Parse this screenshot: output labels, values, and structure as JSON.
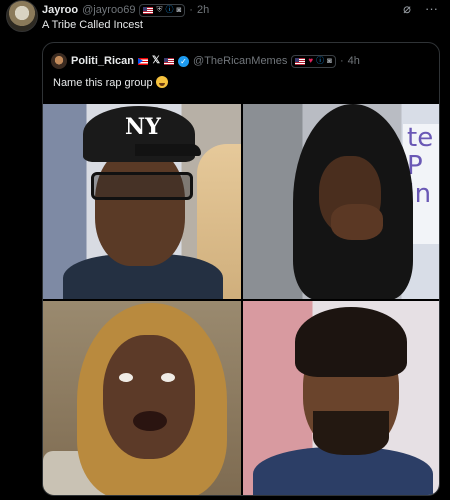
{
  "tweet": {
    "author_name": "Jayroo",
    "handle": "@jayroo69",
    "time": "2h",
    "text": "A Tribe Called Incest",
    "icons": [
      "us-flag-icon",
      "shield-icon",
      "info-icon",
      "camera-icon"
    ]
  },
  "top_actions": {
    "grok_icon": "⌀",
    "more_icon": "···"
  },
  "quoted_tweet": {
    "author_name": "Politi_Rican",
    "handle": "@TheRicanMemes",
    "time": "4h",
    "text": "Name this rap group",
    "header_flags": [
      "puerto-rico-flag-icon",
      "x-icon",
      "us-flag-icon",
      "verified-icon"
    ],
    "badge_icons": [
      "us-flag-icon",
      "heart-icon",
      "info-icon",
      "camera-icon"
    ],
    "emoji": "face-with-tears-of-joy"
  },
  "media": {
    "photos": [
      {
        "id": "photo-1",
        "cap_logo": "NY"
      },
      {
        "id": "photo-2",
        "sign_text": "te P In"
      },
      {
        "id": "photo-3"
      },
      {
        "id": "photo-4"
      }
    ]
  },
  "colors": {
    "background": "#000000",
    "text": "#e7e9ea",
    "muted": "#71767b",
    "accent": "#1d9bf0",
    "border": "#2f3336"
  }
}
